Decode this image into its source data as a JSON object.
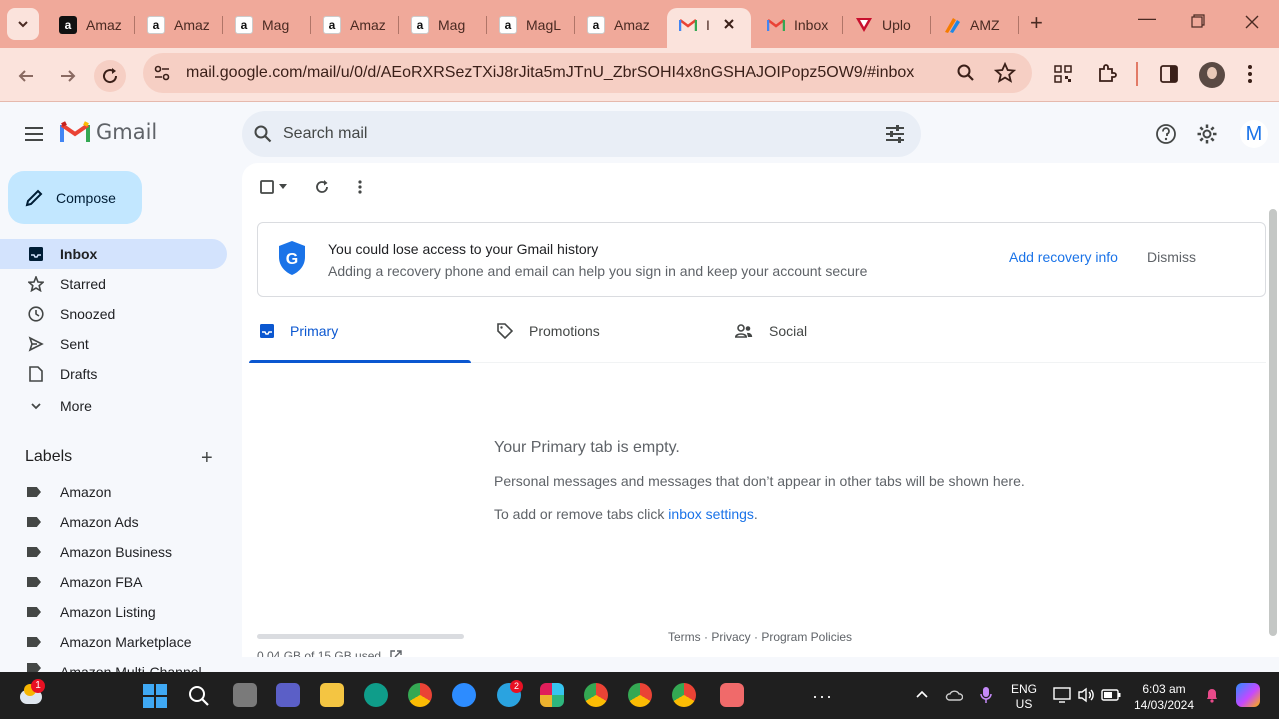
{
  "browser": {
    "tabs": [
      {
        "title": "Amaz",
        "favicon": "amazon-icon"
      },
      {
        "title": "Amaz",
        "favicon": "amazon-icon"
      },
      {
        "title": "Mag",
        "favicon": "amazon-icon"
      },
      {
        "title": "Amaz",
        "favicon": "amazon-icon"
      },
      {
        "title": "Mag",
        "favicon": "amazon-icon"
      },
      {
        "title": "MagL",
        "favicon": "amazon-icon"
      },
      {
        "title": "Amaz",
        "favicon": "amazon-icon"
      },
      {
        "title": "I",
        "favicon": "gmail-icon",
        "active": true
      },
      {
        "title": "Inbox",
        "favicon": "gmail-icon"
      },
      {
        "title": "Uplo",
        "favicon": "upload-icon"
      },
      {
        "title": "AMZ",
        "favicon": "amz-icon"
      }
    ],
    "url": "mail.google.com/mail/u/0/d/AEoRXRSezTXiJ8rJita5mJTnU_ZbrSOHI4x8nGSHAJOIPopz5OW9/#inbox"
  },
  "gmail": {
    "logo_text": "Gmail",
    "search_placeholder": "Search mail",
    "avatar_letter": "M",
    "compose_label": "Compose",
    "nav": [
      {
        "label": "Inbox",
        "icon": "inbox-icon",
        "active": true
      },
      {
        "label": "Starred",
        "icon": "star-icon"
      },
      {
        "label": "Snoozed",
        "icon": "clock-icon"
      },
      {
        "label": "Sent",
        "icon": "send-icon"
      },
      {
        "label": "Drafts",
        "icon": "draft-icon"
      },
      {
        "label": "More",
        "icon": "chevron-down-icon"
      }
    ],
    "labels_title": "Labels",
    "labels": [
      "Amazon",
      "Amazon Ads",
      "Amazon Business",
      "Amazon FBA",
      "Amazon Listing",
      "Amazon Marketplace",
      "Amazon Multi-Channel"
    ],
    "banner": {
      "title": "You could lose access to your Gmail history",
      "subtitle": "Adding a recovery phone and email can help you sign in and keep your account secure",
      "action": "Add recovery info",
      "dismiss": "Dismiss"
    },
    "tabs": [
      {
        "label": "Primary",
        "active": true
      },
      {
        "label": "Promotions"
      },
      {
        "label": "Social"
      }
    ],
    "empty": {
      "title": "Your Primary tab is empty.",
      "message": "Personal messages and messages that don’t appear in other tabs will be shown here.",
      "settings_prefix": "To add or remove tabs click ",
      "settings_link": "inbox settings",
      "settings_suffix": "."
    },
    "storage": "0.04 GB of 15 GB used",
    "footer": "Terms · Privacy · Program Policies"
  },
  "taskbar": {
    "weather_badge": "1",
    "telegram_badge": "2",
    "lang_line1": "ENG",
    "lang_line2": "US",
    "time": "6:03 am",
    "date": "14/03/2024"
  },
  "colors": {
    "chrome_bg": "#f0a99a",
    "toolbar_bg": "#fbe3dc",
    "accent": "#0b57d0",
    "compose": "#c2e7ff",
    "nav_active": "#d3e3fd"
  }
}
